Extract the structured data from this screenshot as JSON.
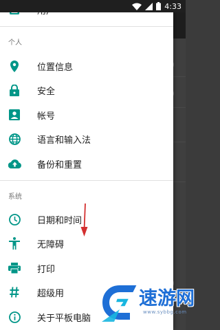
{
  "status_bar": {
    "time": "4:33",
    "icons": [
      "wifi-icon",
      "signal-icon",
      "battery-icon"
    ]
  },
  "drawer": {
    "top_item": {
      "label": "用户",
      "icon": "person-icon"
    },
    "sections": [
      {
        "header": "个人",
        "items": [
          {
            "label": "位置信息",
            "icon": "location-pin-icon"
          },
          {
            "label": "安全",
            "icon": "lock-icon"
          },
          {
            "label": "帐号",
            "icon": "account-box-icon"
          },
          {
            "label": "语言和输入法",
            "icon": "globe-icon"
          },
          {
            "label": "备份和重置",
            "icon": "cloud-upload-icon"
          }
        ]
      },
      {
        "header": "系统",
        "items": [
          {
            "label": "日期和时间",
            "icon": "clock-icon"
          },
          {
            "label": "无障碍",
            "icon": "accessibility-icon"
          },
          {
            "label": "打印",
            "icon": "printer-icon"
          },
          {
            "label": "超级用",
            "icon": "hash-icon"
          },
          {
            "label": "关于平板电脑",
            "icon": "info-icon"
          }
        ]
      }
    ]
  },
  "watermark": {
    "text": "速游网",
    "url": "www.sybbg.com"
  },
  "colors": {
    "icon_teal": "#009688",
    "annotation_red": "#d32f2f",
    "watermark_blue": "#1e6fd6"
  }
}
